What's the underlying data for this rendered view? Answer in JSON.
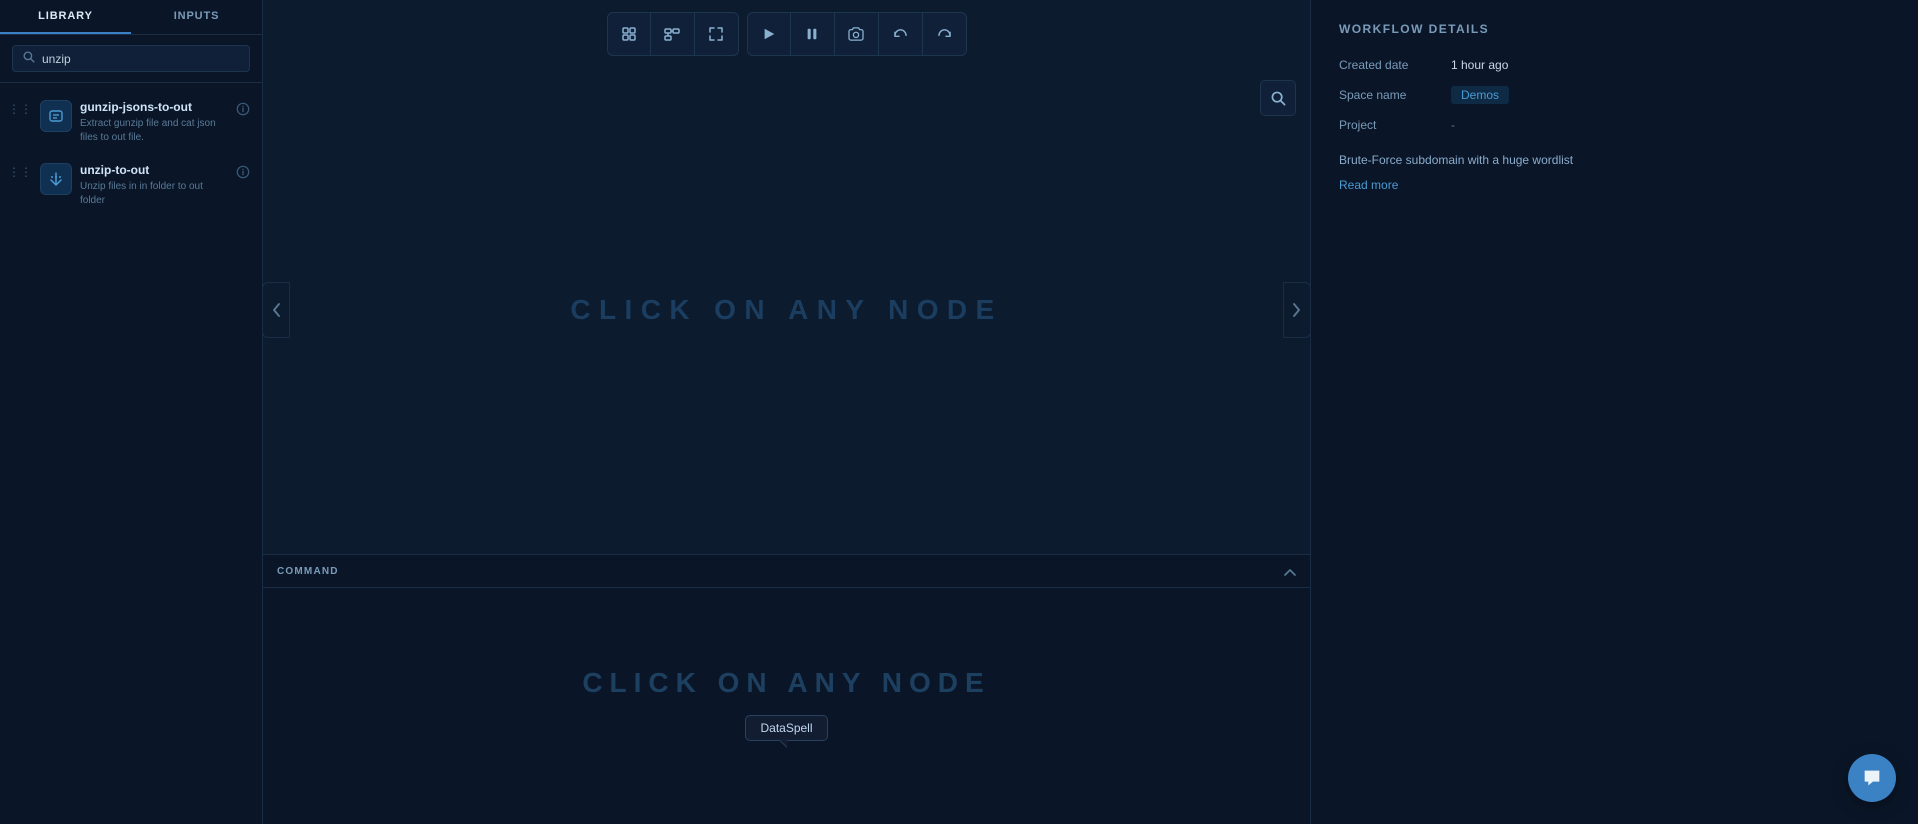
{
  "sidebar": {
    "tab_library": "Library",
    "tab_inputs": "Inputs",
    "active_tab": "library",
    "search_placeholder": "unzip",
    "search_value": "unzip",
    "items": [
      {
        "id": "gunzip-jsons-to-out",
        "title": "gunzip-jsons-to-out",
        "description": "Extract gunzip file and cat json files to out file.",
        "icon": "⌘"
      },
      {
        "id": "unzip-to-out",
        "title": "unzip-to-out",
        "description": "Unzip files in in folder to out folder",
        "icon": "✕"
      }
    ]
  },
  "toolbar": {
    "run_label": "▶",
    "pause_label": "⏸",
    "snapshot_label": "📷",
    "undo_label": "↩",
    "redo_label": "↪"
  },
  "canvas": {
    "click_node_text": "CLICK  ON  ANY  NODE",
    "search_icon": "🔍"
  },
  "command_panel": {
    "label": "COMMAND",
    "click_hint": "CLICK  ON  ANY  NODE",
    "tooltip": "DataSpell"
  },
  "workflow_details": {
    "panel_title": "WORKFLOW DETAILS",
    "created_date_label": "Created date",
    "created_date_value": "1 hour ago",
    "space_name_label": "Space name",
    "space_name_value": "Demos",
    "project_label": "Project",
    "project_value": "-",
    "description": "Brute-Force subdomain with a huge wordlist",
    "read_more_label": "Read more"
  },
  "chat": {
    "icon": "💬"
  }
}
